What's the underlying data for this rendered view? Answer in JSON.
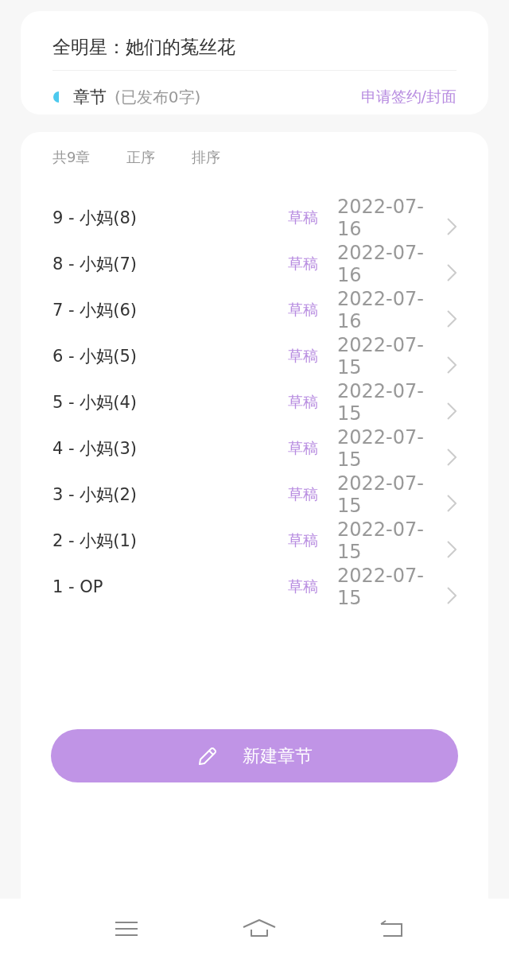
{
  "book": {
    "title": "全明星：她们的菟丝花",
    "section_label": "章节",
    "published_note": "(已发布0字)",
    "sign_link": "申请签约/封面"
  },
  "chapter_list": {
    "count": "共9章",
    "order": "正序",
    "sort": "排序",
    "chapters": [
      {
        "title": "9 - 小妈(8)",
        "status": "草稿",
        "date": "2022-07-16"
      },
      {
        "title": "8 - 小妈(7)",
        "status": "草稿",
        "date": "2022-07-16"
      },
      {
        "title": "7 - 小妈(6)",
        "status": "草稿",
        "date": "2022-07-16"
      },
      {
        "title": "6 - 小妈(5)",
        "status": "草稿",
        "date": "2022-07-15"
      },
      {
        "title": "5 - 小妈(4)",
        "status": "草稿",
        "date": "2022-07-15"
      },
      {
        "title": "4 - 小妈(3)",
        "status": "草稿",
        "date": "2022-07-15"
      },
      {
        "title": "3 - 小妈(2)",
        "status": "草稿",
        "date": "2022-07-15"
      },
      {
        "title": "2 - 小妈(1)",
        "status": "草稿",
        "date": "2022-07-15"
      },
      {
        "title": "1 - OP",
        "status": "草稿",
        "date": "2022-07-15"
      }
    ]
  },
  "new_chapter_button": {
    "label": "新建章节"
  }
}
